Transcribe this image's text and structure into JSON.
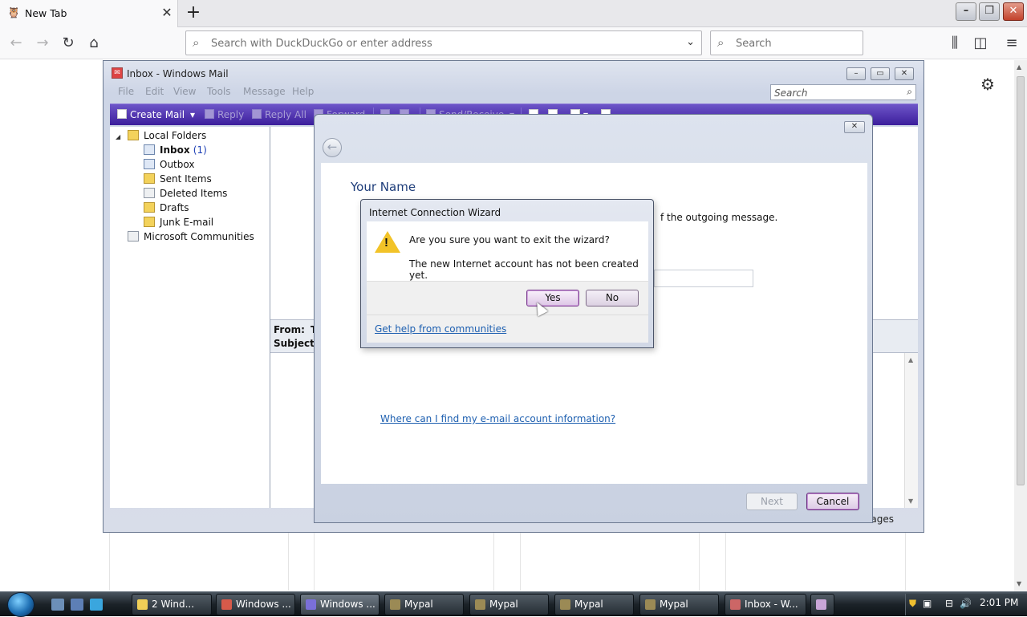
{
  "browser": {
    "tab_title": "New Tab",
    "tab_favicon": "mypal-icon",
    "url_placeholder": "Search with DuckDuckGo or enter address",
    "search_placeholder": "Search"
  },
  "mail": {
    "title": "Inbox - Windows Mail",
    "menu": [
      "File",
      "Edit",
      "View",
      "Tools",
      "Message",
      "Help"
    ],
    "search_placeholder": "Search",
    "toolbar": {
      "create_mail": "Create Mail",
      "reply": "Reply",
      "reply_all": "Reply All",
      "forward": "Forward",
      "send_receive": "Send/Receive"
    },
    "folders": {
      "root": "Local Folders",
      "inbox": "Inbox",
      "inbox_count": "(1)",
      "outbox": "Outbox",
      "sent": "Sent Items",
      "deleted": "Deleted Items",
      "drafts": "Drafts",
      "junk": "Junk E-mail",
      "communities": "Microsoft Communities"
    },
    "preview": {
      "from_label": "From:",
      "from_value": "T",
      "subject_label": "Subject:"
    },
    "status_text": "ages"
  },
  "wizard": {
    "heading": "Your Name",
    "description_fragment": "f the outgoing message.",
    "help_link": "Where can I find my e-mail account information?",
    "next_label": "Next",
    "cancel_label": "Cancel"
  },
  "dialog": {
    "title": "Internet Connection Wizard",
    "question": "Are you sure you want to exit the wizard?",
    "message": "The new Internet account has not been created yet.",
    "yes_label": "Yes",
    "no_label": "No",
    "help_link": "Get help from communities"
  },
  "taskbar": {
    "tasks": [
      "2 Wind...",
      "Windows ...",
      "Windows ...",
      "Mypal",
      "Mypal",
      "Mypal",
      "Mypal",
      "Inbox - W..."
    ],
    "clock": "2:01 PM"
  },
  "colors": {
    "mail_toolbar": "#4a2fb0",
    "link": "#1d5fb0",
    "warning": "#f2c328"
  }
}
